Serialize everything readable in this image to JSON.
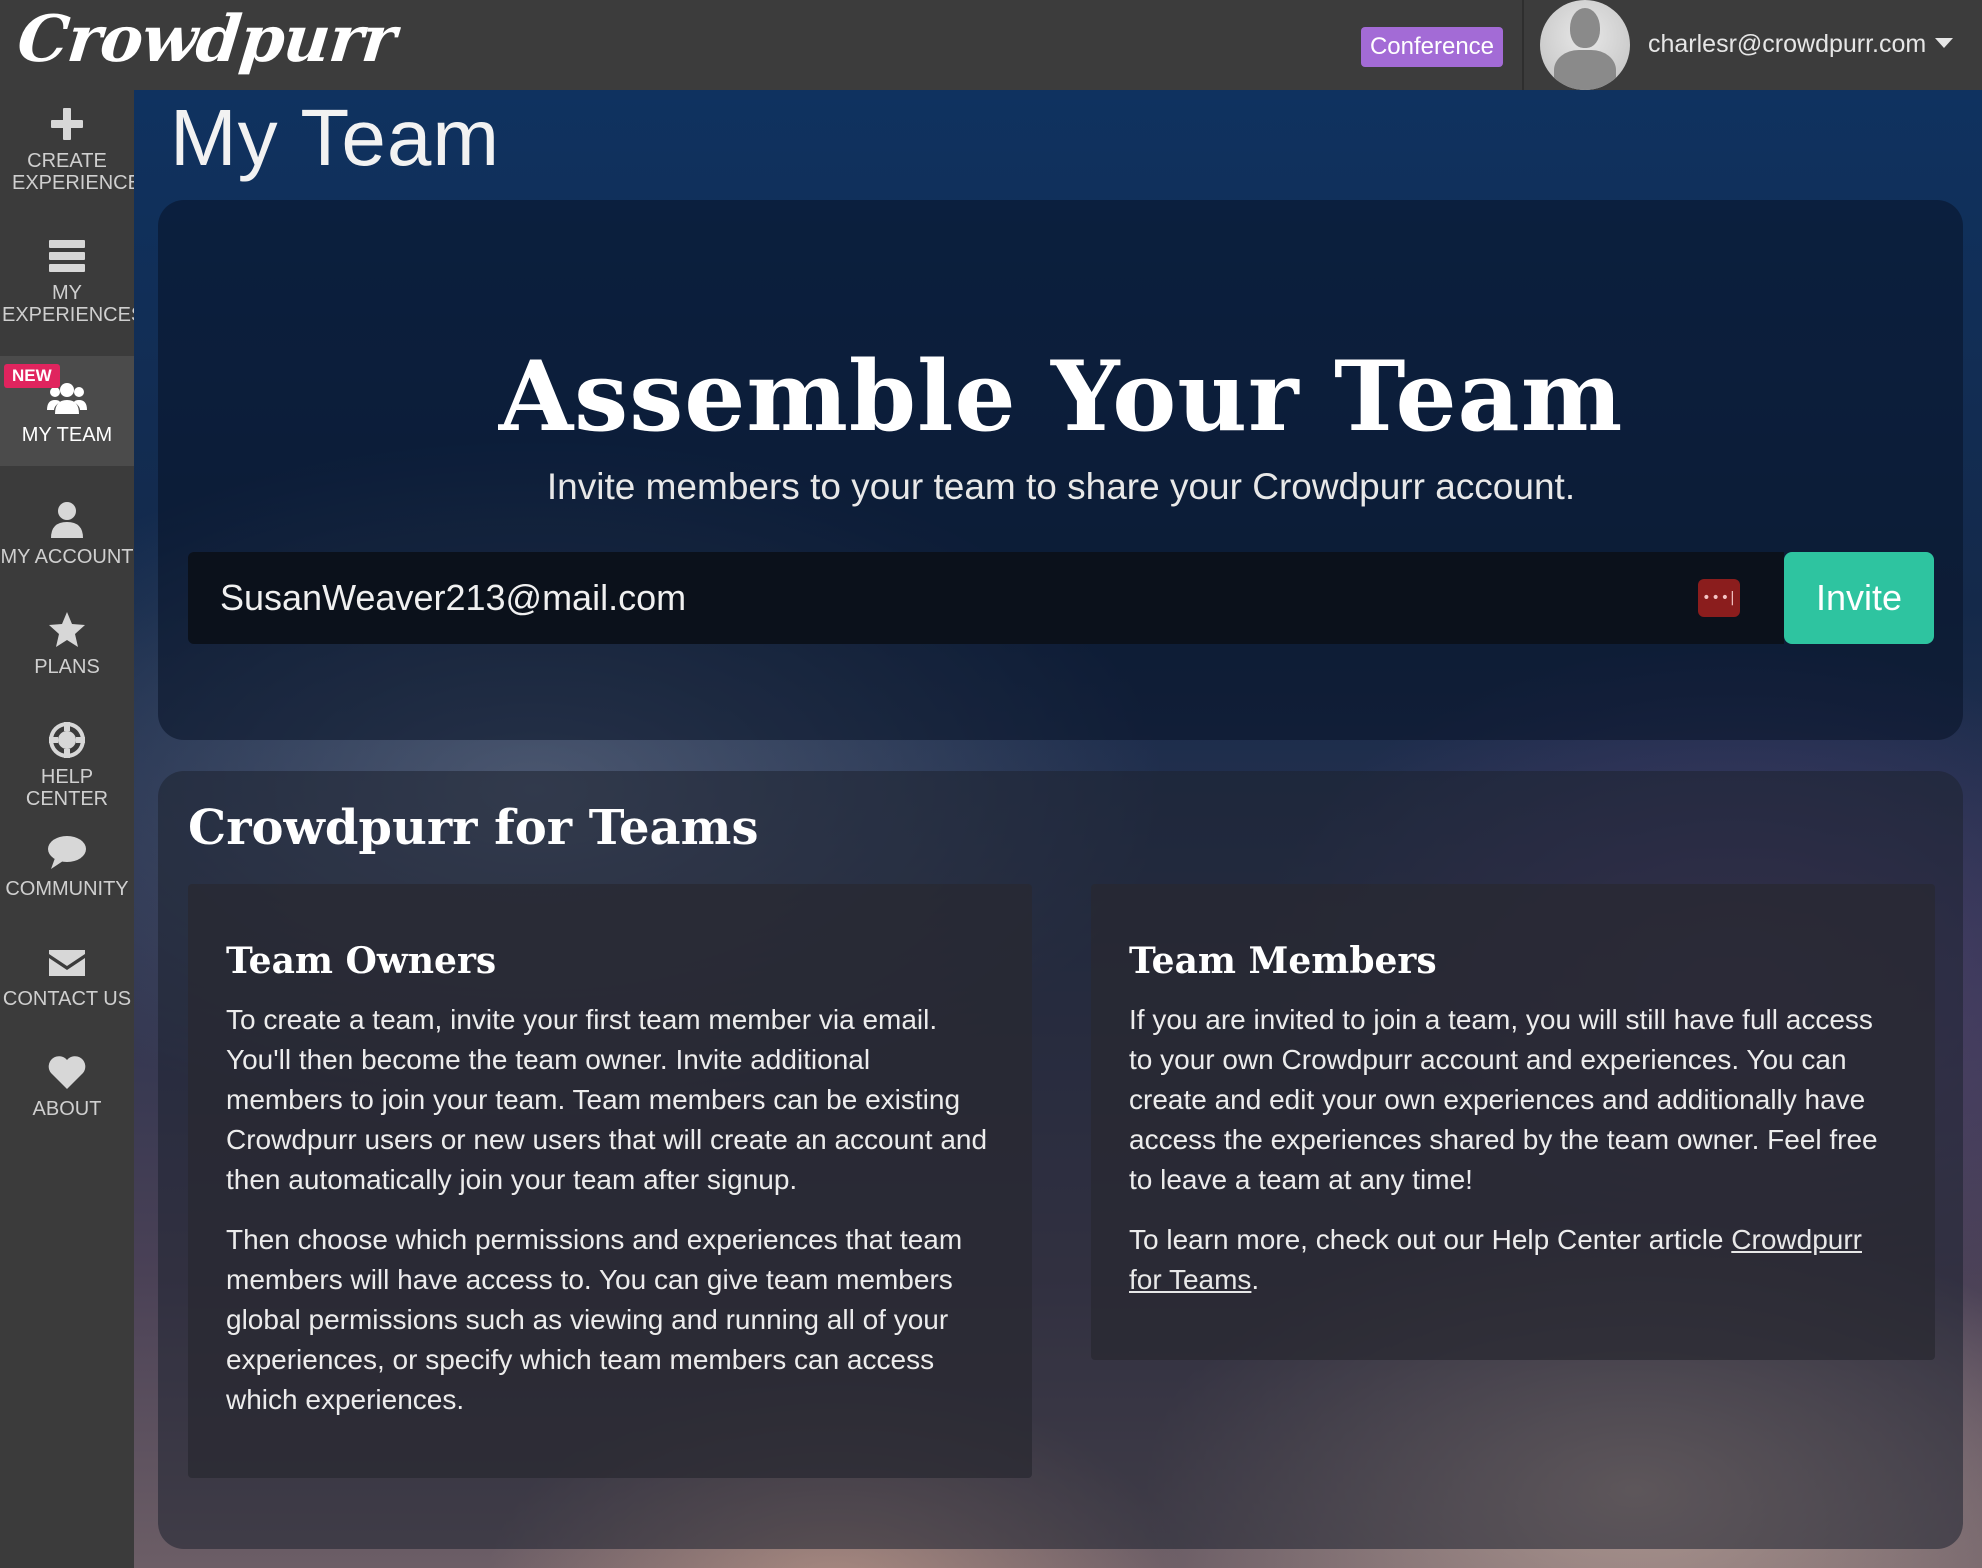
{
  "header": {
    "logo_text": "Crowdpurr",
    "plan_badge": "Conference",
    "user_email": "charlesr@crowdpurr.com",
    "user_menu_icon": "chevron-down-icon",
    "avatar_icon": "user-silhouette-icon"
  },
  "sidebar": {
    "new_badge": "NEW",
    "items": [
      {
        "label": "CREATE EXPERIENCE",
        "icon": "plus-icon"
      },
      {
        "label": "MY EXPERIENCES",
        "icon": "server-icon"
      },
      {
        "label": "MY TEAM",
        "icon": "users-icon"
      },
      {
        "label": "MY ACCOUNT",
        "icon": "user-icon"
      },
      {
        "label": "PLANS",
        "icon": "star-icon"
      },
      {
        "label": "HELP CENTER",
        "icon": "life-ring-icon"
      },
      {
        "label": "COMMUNITY",
        "icon": "comment-icon"
      },
      {
        "label": "CONTACT US",
        "icon": "envelope-icon"
      },
      {
        "label": "ABOUT",
        "icon": "heart-icon"
      }
    ]
  },
  "page": {
    "title": "My Team"
  },
  "hero": {
    "title": "Assemble Your Team",
    "subtitle": "Invite members to your team to share your Crowdpurr account.",
    "input_value": "SusanWeaver213@mail.com",
    "invite_label": "Invite"
  },
  "teams": {
    "title": "Crowdpurr for Teams",
    "owners": {
      "heading": "Team Owners",
      "p1": "To create a team, invite your first team member via email. You'll then become the team owner. Invite additional members to join your team. Team members can be existing Crowdpurr users or new users that will create an account and then automatically join your team after signup.",
      "p2": "Then choose which permissions and experiences that team members will have access to. You can give team members global permissions such as viewing and running all of your experiences, or specify which team members can access which experiences."
    },
    "members": {
      "heading": "Team Members",
      "p1": "If you are invited to join a team, you will still have full access to your own Crowdpurr account and experiences. You can create and edit your own experiences and additionally have access the experiences shared by the team owner. Feel free to leave a team at any time!",
      "p2_prefix": "To learn more, check out our Help Center article ",
      "p2_link": "Crowdpurr for Teams",
      "p2_suffix": "."
    }
  },
  "colors": {
    "topbar": "#3c3c3c",
    "sidebar": "#3b3b3b",
    "plan_badge": "#a36bd6",
    "invite_button": "#2ec4a0",
    "new_badge": "#e0245e"
  }
}
